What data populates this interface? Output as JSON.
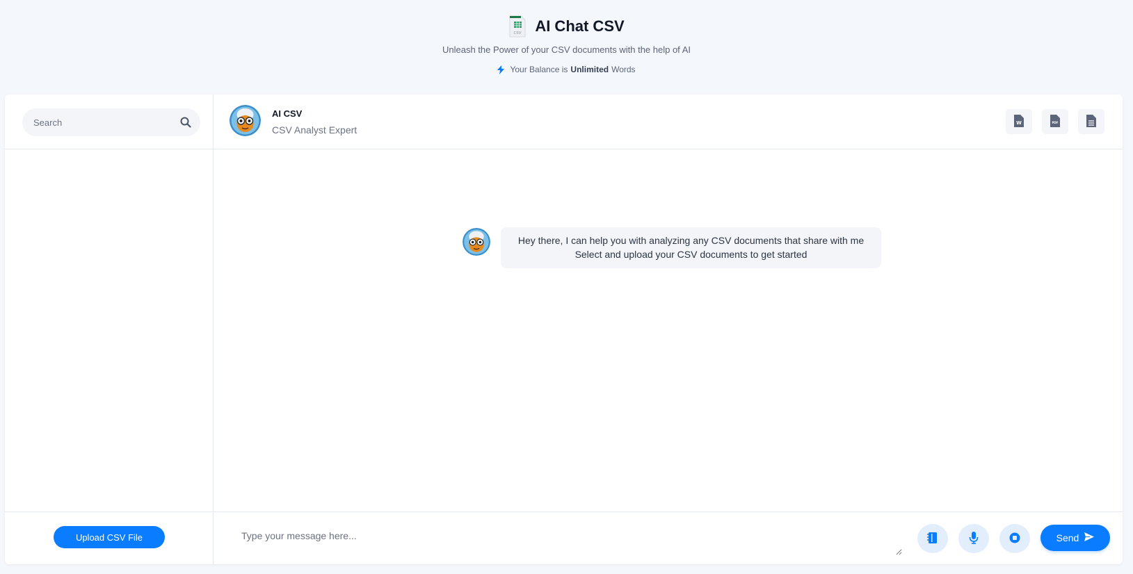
{
  "header": {
    "title": "AI Chat CSV",
    "subtitle": "Unleash the Power of your CSV documents with the help of AI",
    "balance_prefix": "Your Balance is",
    "balance_value": "Unlimited",
    "balance_suffix": "Words",
    "logo_icon": "csv-file-icon",
    "logo_text": "CSV"
  },
  "sidebar": {
    "search_placeholder": "Search",
    "upload_label": "Upload CSV File"
  },
  "chat": {
    "bot_name": "AI CSV",
    "bot_role": "CSV Analyst Expert",
    "export_buttons": [
      "word-export-icon",
      "pdf-export-icon",
      "text-export-icon"
    ],
    "messages": [
      {
        "sender": "bot",
        "lines": [
          "Hey there, I can help you with analyzing any CSV documents that share with me",
          "Select and upload your CSV documents to get started"
        ]
      }
    ],
    "input_placeholder": "Type your message here...",
    "send_label": "Send"
  },
  "colors": {
    "accent": "#0a7cff",
    "background": "#f4f7fb",
    "bubble": "#f3f5f9",
    "round_button": "#e3eefc"
  }
}
